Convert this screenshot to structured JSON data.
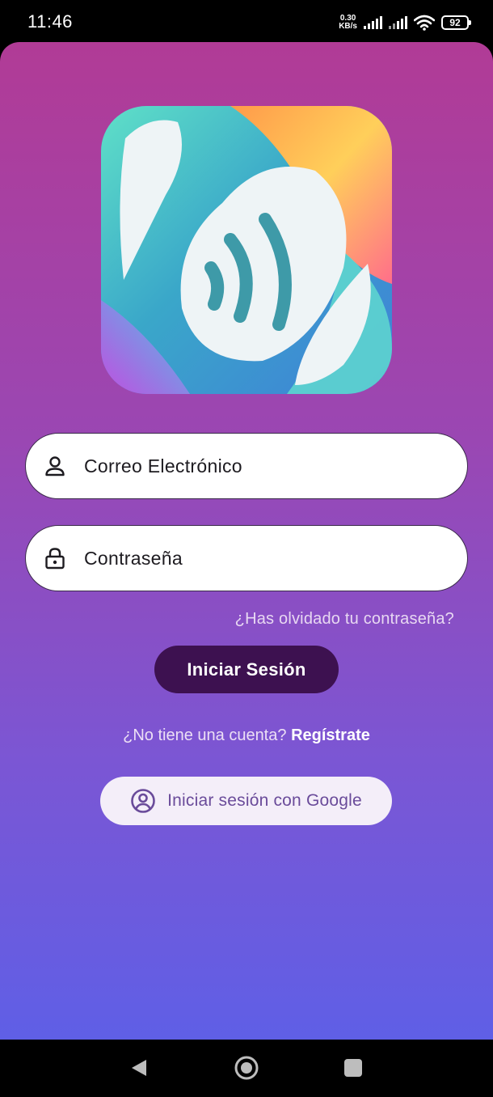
{
  "status_bar": {
    "time": "11:46",
    "net_speed_value": "0.30",
    "net_speed_unit": "KB/s",
    "battery": "92"
  },
  "login": {
    "email_placeholder": "Correo Electrónico",
    "password_placeholder": "Contraseña",
    "forgot_password": "¿Has olvidado tu contraseña?",
    "login_button": "Iniciar Sesión",
    "no_account_text": "¿No tiene una cuenta?",
    "register_link": "Regístrate",
    "google_button": "Iniciar sesión con Google"
  },
  "icons": {
    "email": "person-icon",
    "password": "lock-icon",
    "google": "account-circle-icon",
    "logo": "app-logo"
  },
  "colors": {
    "gradient_top": "#b13b96",
    "gradient_bottom": "#5f5fe6",
    "login_button_bg": "#3d1150",
    "google_button_bg": "#f4eef9",
    "google_text": "#6a4b9a"
  }
}
